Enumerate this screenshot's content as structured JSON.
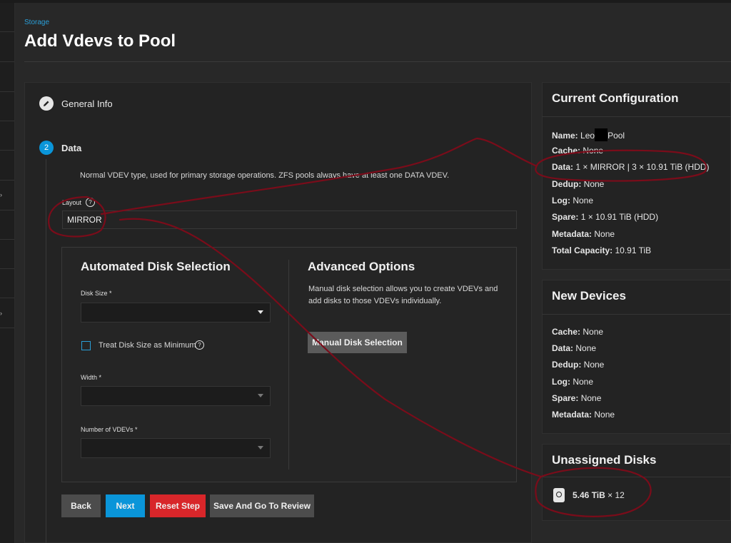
{
  "breadcrumb": "Storage",
  "page_title": "Add Vdevs to Pool",
  "steps": [
    {
      "label": "General Info",
      "icon": "pencil-icon"
    },
    {
      "number": "2",
      "label": "Data"
    }
  ],
  "data_step": {
    "description": "Normal VDEV type, used for primary storage operations. ZFS pools always have at least one DATA VDEV.",
    "layout_label": "Layout",
    "layout_value": "MIRROR"
  },
  "automated": {
    "title": "Automated Disk Selection",
    "disk_size_label": "Disk Size *",
    "treat_min_label": "Treat Disk Size as Minimum",
    "width_label": "Width *",
    "num_vdevs_label": "Number of VDEVs *"
  },
  "advanced": {
    "title": "Advanced Options",
    "description": "Manual disk selection allows you to create VDEVs and add disks to those VDEVs individually.",
    "manual_button": "Manual Disk Selection"
  },
  "buttons": {
    "back": "Back",
    "next": "Next",
    "reset": "Reset Step",
    "review": "Save And Go To Review"
  },
  "current_config": {
    "title": "Current Configuration",
    "name_label": "Name:",
    "name_prefix": "Leo",
    "name_suffix": "Pool",
    "cache_label": "Cache:",
    "cache": "None",
    "data_label": "Data:",
    "data": "1 × MIRROR | 3 × 10.91 TiB (HDD)",
    "dedup_label": "Dedup:",
    "dedup": "None",
    "log_label": "Log:",
    "log": "None",
    "spare_label": "Spare:",
    "spare": "1 × 10.91 TiB (HDD)",
    "metadata_label": "Metadata:",
    "metadata": "None",
    "capacity_label": "Total Capacity:",
    "capacity": "10.91 TiB"
  },
  "new_devices": {
    "title": "New Devices",
    "cache_label": "Cache:",
    "cache": "None",
    "data_label": "Data:",
    "data": "None",
    "dedup_label": "Dedup:",
    "dedup": "None",
    "log_label": "Log:",
    "log": "None",
    "spare_label": "Spare:",
    "spare": "None",
    "metadata_label": "Metadata:",
    "metadata": "None"
  },
  "unassigned": {
    "title": "Unassigned Disks",
    "size": "5.46 TiB",
    "count": "× 12"
  },
  "colors": {
    "accent": "#0a95d9",
    "danger": "#d8262a",
    "annotation": "#7a0c1a"
  }
}
